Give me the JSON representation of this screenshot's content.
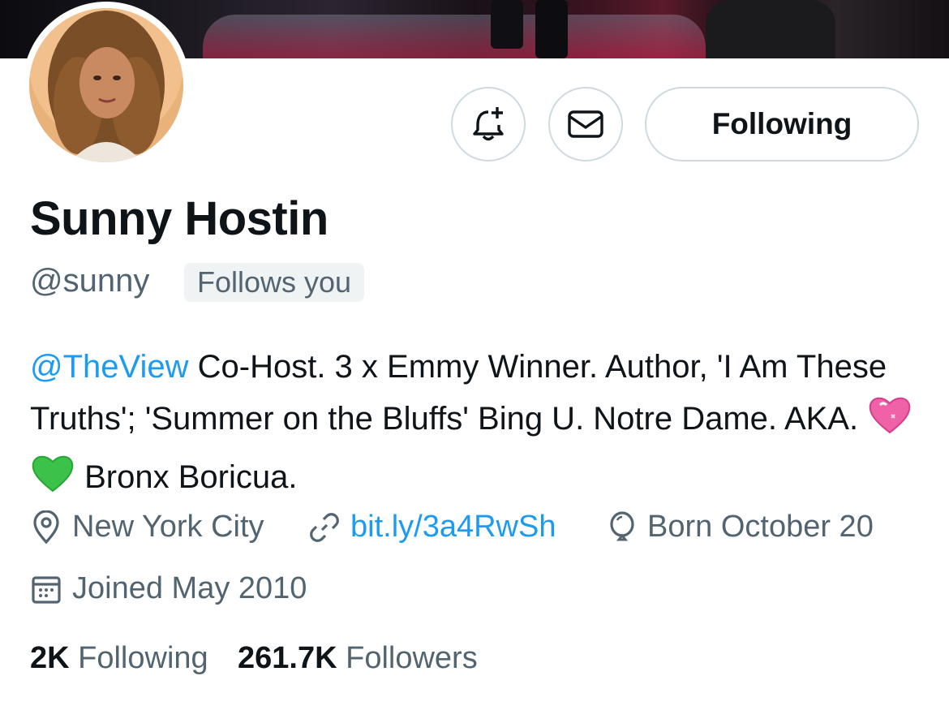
{
  "profile": {
    "name": "Sunny Hostin",
    "handle": "@sunny",
    "follows_you": "Follows you",
    "bio_mention": "@TheView",
    "bio_text": " Co-Host. 3 x Emmy Winner. Author, 'I Am These Truths'; 'Summer on the Bluffs' Bing U. Notre Dame. AKA. ",
    "bio_tail": " Bronx Boricua.",
    "bio_emojis": [
      "pink-sparkling-heart-emoji",
      "green-heart-emoji"
    ]
  },
  "actions": {
    "following_label": "Following",
    "notify_icon": "bell-plus-icon",
    "message_icon": "envelope-icon"
  },
  "meta": {
    "location": "New York City",
    "link": "bit.ly/3a4RwSh",
    "birthday": "Born October 20",
    "joined": "Joined May 2010"
  },
  "stats": {
    "following_count": "2K",
    "following_label": "Following",
    "followers_count": "261.7K",
    "followers_label": "Followers"
  },
  "colors": {
    "accent": "#1d9bf0",
    "secondary_text": "#536471",
    "border": "#cfd9de",
    "badge_bg": "#eff3f4"
  }
}
